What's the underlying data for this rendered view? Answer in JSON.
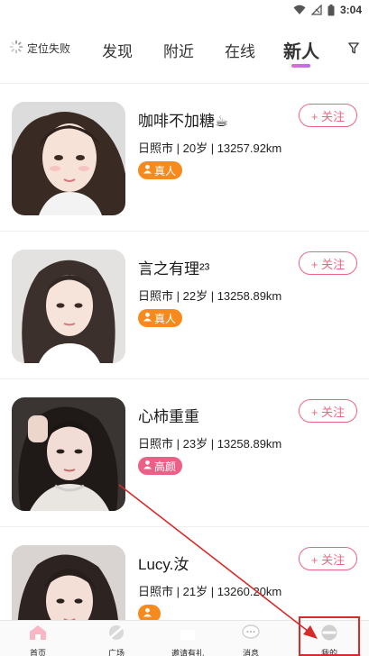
{
  "status_bar": {
    "time": "3:04"
  },
  "top_nav": {
    "location": "定位失败",
    "tabs": [
      "发现",
      "附近",
      "在线",
      "新人"
    ],
    "active_tab": "新人"
  },
  "users": [
    {
      "name": "咖啡不加糖☕",
      "city": "日照市",
      "age": "20岁",
      "distance": "13257.92km",
      "badge": "真人",
      "badge_color": "#f78a1d",
      "follow_label": "+ 关注"
    },
    {
      "name": "言之有理²³",
      "city": "日照市",
      "age": "22岁",
      "distance": "13258.89km",
      "badge": "真人",
      "badge_color": "#f78a1d",
      "follow_label": "+ 关注"
    },
    {
      "name": "心柿重重",
      "city": "日照市",
      "age": "23岁",
      "distance": "13258.89km",
      "badge": "高颜",
      "badge_color": "#ec5f86",
      "follow_label": "+ 关注"
    },
    {
      "name": "Lucy.汝",
      "city": "日照市",
      "age": "21岁",
      "distance": "13260.20km",
      "badge": "",
      "badge_color": "#f78a1d",
      "follow_label": "+ 关注"
    }
  ],
  "bottom_bar": {
    "items": [
      {
        "label": "首页",
        "icon": "home-icon"
      },
      {
        "label": "广场",
        "icon": "plaza-icon"
      },
      {
        "label": "邀请有礼",
        "icon": "gift-icon"
      },
      {
        "label": "消息",
        "icon": "message-icon"
      },
      {
        "label": "我的",
        "icon": "profile-icon"
      }
    ]
  },
  "colors": {
    "accent": "#f06584",
    "badge_orange": "#f78a1d",
    "badge_pink": "#ec5f86",
    "annotation_red": "#d82a2a"
  }
}
